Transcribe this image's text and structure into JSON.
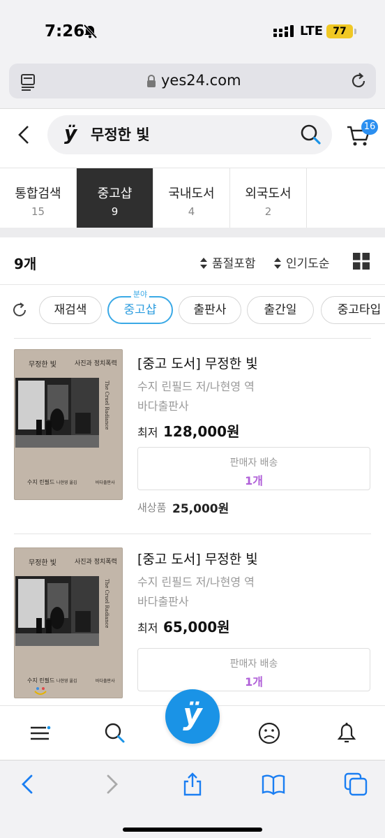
{
  "status_bar": {
    "time": "7:26",
    "carrier": "LTE",
    "battery": "77",
    "icons": [
      "bell-slash-icon",
      "signal-icon"
    ]
  },
  "browser": {
    "url": "yes24.com",
    "icons": [
      "reader-icon",
      "lock-icon",
      "reload-icon"
    ]
  },
  "header": {
    "brand_mark": "ÿ",
    "query": "무정한 빛",
    "cart_badge": "16",
    "icons": [
      "back-icon",
      "search-icon",
      "cart-icon"
    ]
  },
  "tabs": [
    {
      "label": "통합검색",
      "count": "15",
      "active": false
    },
    {
      "label": "중고샵",
      "count": "9",
      "active": true
    },
    {
      "label": "국내도서",
      "count": "4",
      "active": false
    },
    {
      "label": "외국도서",
      "count": "2",
      "active": false
    }
  ],
  "results": {
    "count_label": "9개",
    "sort_options": [
      "품절포함",
      "인기도순"
    ],
    "icons": [
      "grid-icon"
    ]
  },
  "filters": {
    "chips": [
      "재검색",
      "중고샵",
      "출판사",
      "출간일",
      "중고타입"
    ],
    "active_chip_tag": "분야",
    "icons": [
      "refresh-icon"
    ]
  },
  "cover": {
    "title": "무정한 빛",
    "subtitle": "사진과 정치폭력",
    "side_text": "The Cruel Radiance",
    "author": "수지 린필드",
    "translator": "나현영 옮김",
    "publisher": "바다출판사"
  },
  "products": [
    {
      "title": "[중고 도서] 무정한 빛",
      "author": "수지 린필드 저/나현영 역",
      "publisher": "바다출판사",
      "price_label": "최저",
      "price": "128,000원",
      "seller_label": "판매자 배송",
      "seller_count": "1개",
      "new_price_label": "새상품",
      "new_price": "25,000원"
    },
    {
      "title": "[중고 도서] 무정한 빛",
      "author": "수지 린필드 저/나현영 역",
      "publisher": "바다출판사",
      "price_label": "최저",
      "price": "65,000원",
      "seller_label": "판매자 배송",
      "seller_count": "1개"
    }
  ],
  "bottom_nav": {
    "center_mark": "ÿ",
    "icons": [
      "menu-icon",
      "search-icon",
      "yes24-home-icon",
      "profile-icon",
      "bell-icon"
    ]
  },
  "safari_toolbar": {
    "icons": [
      "back-arrow-icon",
      "forward-arrow-icon",
      "share-icon",
      "bookmarks-icon",
      "tabs-icon"
    ]
  },
  "colors": {
    "accent_blue": "#1a93e6",
    "active_chip": "#3aa9e6",
    "seller_count": "#b060d8",
    "active_tab_bg": "#2f2f2f",
    "battery": "#f0c824"
  }
}
